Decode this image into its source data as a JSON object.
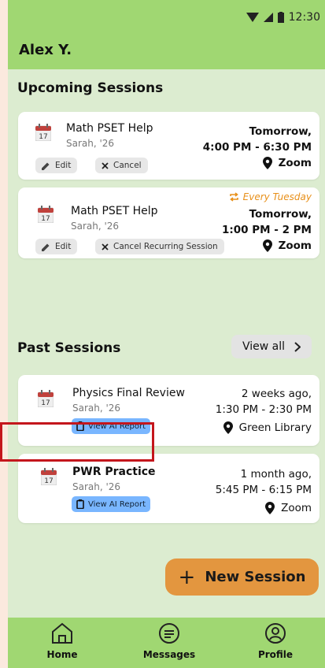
{
  "status_bar": {
    "time": "12:30"
  },
  "user": {
    "name": "Alex Y."
  },
  "upcoming": {
    "title": "Upcoming Sessions",
    "sessions": [
      {
        "title": "Math PSET Help",
        "tutor": "Sarah, '26",
        "day": "Tomorrow,",
        "time": "4:00 PM - 6:30 PM",
        "location": "Zoom",
        "edit_label": "Edit",
        "cancel_label": "Cancel",
        "calendar_day": "17"
      },
      {
        "title": "Math PSET Help",
        "tutor": "Sarah, '26",
        "recurrence": "Every Tuesday",
        "day": "Tomorrow,",
        "time": "1:00 PM - 2 PM",
        "location": "Zoom",
        "edit_label": "Edit",
        "cancel_label": "Cancel Recurring Session",
        "calendar_day": "17"
      }
    ]
  },
  "past": {
    "title": "Past Sessions",
    "view_all": "View all",
    "sessions": [
      {
        "title": "Physics Final Review",
        "tutor": "Sarah, '26",
        "day": "2 weeks ago,",
        "time": "1:30 PM - 2:30 PM",
        "location": "Green Library",
        "report_label": "View AI Report",
        "calendar_day": "17"
      },
      {
        "title": "PWR Practice",
        "tutor": "Sarah, '26",
        "day": "1 month ago,",
        "time": "5:45 PM - 6:15 PM",
        "location": "Zoom",
        "report_label": "View AI Report",
        "calendar_day": "17"
      }
    ]
  },
  "new_session": {
    "label": "New Session",
    "icon": "+"
  },
  "nav": [
    {
      "label": "Home",
      "icon": "home-icon"
    },
    {
      "label": "Messages",
      "icon": "message-icon"
    },
    {
      "label": "Profile",
      "icon": "profile-icon"
    }
  ],
  "colors": {
    "header": "#a0d772",
    "background": "#dcecd0",
    "accent": "#e3963f",
    "ai_button": "#79b6ff",
    "recurring": "#e8901a",
    "highlight": "#c4161c"
  }
}
